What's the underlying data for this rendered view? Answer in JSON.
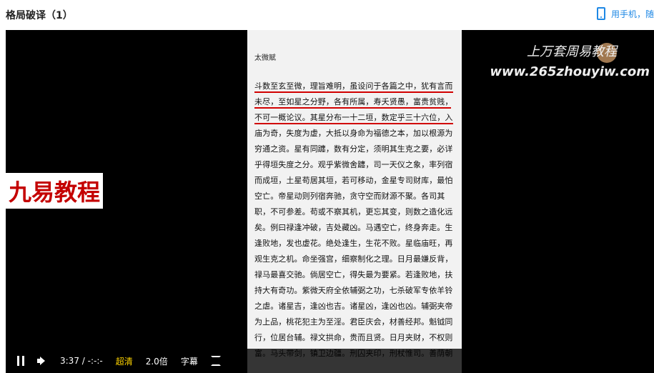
{
  "header": {
    "title": "格局破译（1）",
    "mobile_text": "用手机，随"
  },
  "video": {
    "page_title": "太微赋",
    "lines": [
      "斗数至玄至微，理旨难明，虽设问于各篇之中，犹有言而",
      "未尽，至如星之分野，各有所属，寿夭贤愚，富贵贫贱，",
      "不可一概论议。其星分布一十二垣，数定乎三十六位，入",
      "庙为奇，失度为虚，大抵以身命为福德之本，加以根源为",
      "穷通之资。星有同躔，数有分定，须明其生克之要，必详",
      "乎得垣失度之分。观乎紫微舍躔，司一天仪之象，率列宿",
      "而成垣，土星苟居其垣，若可移动，金星专司财库，最怕",
      "空亡。帝星动则列宿奔驰，贪守空而财源不聚。各司其",
      "职，不可参差。苟或不察其机，更忘其变，则数之造化远",
      "矣。例曰禄逢冲破，吉处藏凶。马遇空亡，终身奔走。生",
      "逢败地，发也虚花。绝处逢生，生花不败。星临庙旺，再",
      "观生克之机。命坐强宫，细察制化之理。日月最嫌反背，",
      "禄马最喜交驰。倘居空亡，得失最为要紧。若逢败地，扶",
      "持大有奇功。紫微天府全依辅弼之功，七杀破军专依羊铃",
      "之虐。诸星吉，逢凶也吉。诸星凶，逢凶也凶。辅弼夹帝",
      "为上品，桃花犯主为至淫。君臣庆会，材善经邦。魁钺同",
      "行，位居台辅。禄文拱命，贵而且贤。日月夹财，不权则",
      "富。马头带剑，镇卫边疆。刑囚夹印，刑杖惟司。善荫朝"
    ],
    "brand_text": "九易教程",
    "watermark_line1": "上万套周易教程",
    "watermark_line2": "www.265zhouyiw.com"
  },
  "controls": {
    "time": "3:37 / -:-:-",
    "quality": "超清",
    "speed": "2.0倍",
    "subtitle": "字幕"
  }
}
